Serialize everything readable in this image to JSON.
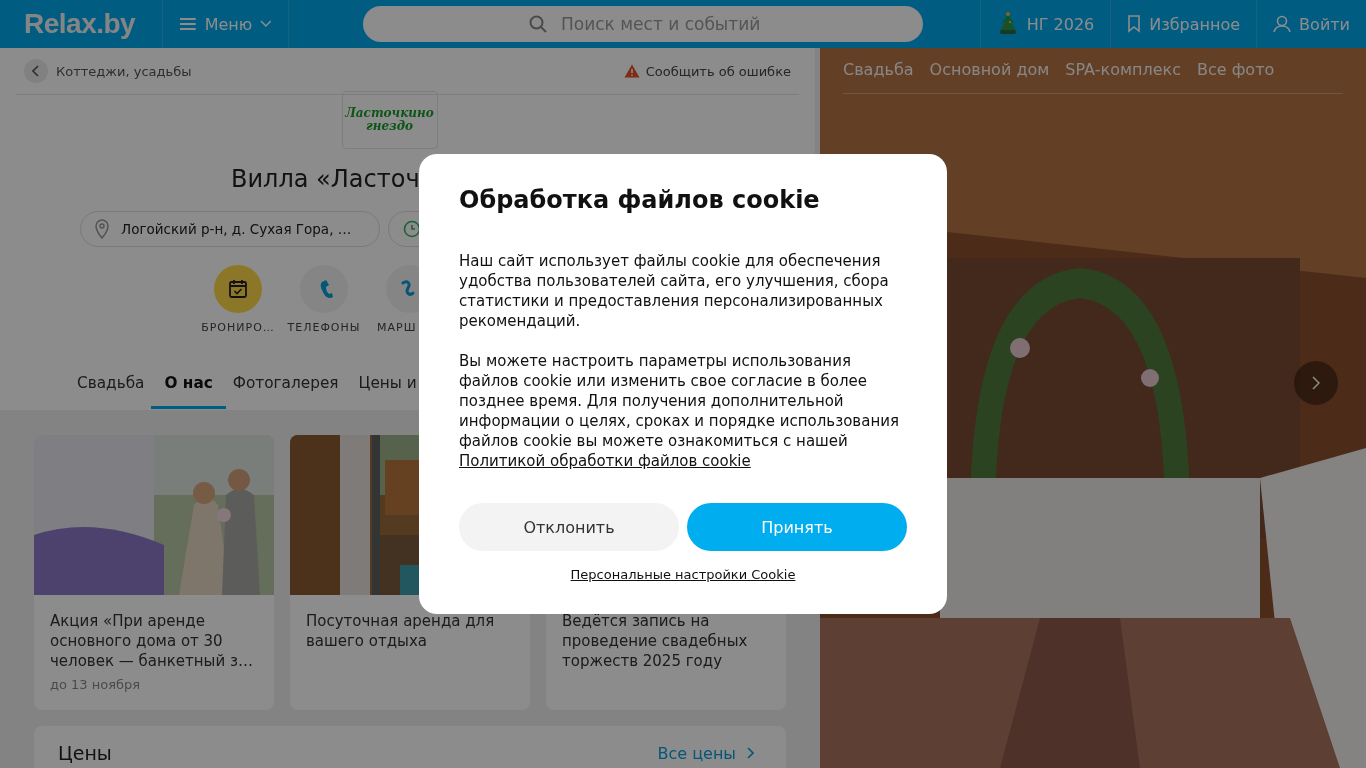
{
  "header": {
    "logo": "Relax.by",
    "menu": "Меню",
    "search": {
      "placeholder": "Поиск мест и событий"
    },
    "links": [
      {
        "kind": "newyear",
        "label": "НГ 2026"
      },
      {
        "kind": "favorites",
        "label": "Избранное"
      },
      {
        "kind": "login",
        "label": "Войти"
      }
    ]
  },
  "breadcrumb": {
    "label": "Коттеджи, усадьбы",
    "report": "Сообщить об ошибке"
  },
  "place": {
    "logo": "Ласточкино гнездо",
    "title": "Вилла «Ласточ",
    "chips": [
      {
        "kind": "address",
        "label": "Логойский р-н, д. Сухая Гора, …"
      },
      {
        "kind": "hours"
      }
    ]
  },
  "actions": [
    {
      "kind": "booking",
      "label": "БРОНИРО…",
      "highlighted": true
    },
    {
      "kind": "phones",
      "label": "ТЕЛЕФОНЫ",
      "highlighted": false
    },
    {
      "kind": "route",
      "label": "МАРШ",
      "highlighted": false
    }
  ],
  "tabs": [
    {
      "label": "Свадьба",
      "selected": false
    },
    {
      "label": "О нас",
      "selected": true
    },
    {
      "label": "Фотогалерея",
      "selected": false
    },
    {
      "label": "Цены и",
      "selected": false
    }
  ],
  "offers": [
    {
      "kind": "picture",
      "text": "Акция «При аренде основного дома от 30 человек — банкетный з…",
      "date": "до 13 ноября"
    },
    {
      "kind": "picture",
      "text": "Посуточная аренда для вашего отдыха"
    },
    {
      "text": "Ведётся запись на проведение свадебных торжеств 2025 году"
    }
  ],
  "prices": {
    "title": "Цены",
    "link": "Все цены"
  },
  "gallery": {
    "tabs": [
      "Свадьба",
      "Основной дом",
      "SPA-комплекс",
      "Все фото"
    ]
  },
  "cookie": {
    "title": "Обработка файлов cookie",
    "paragraphs": [
      "Наш сайт использует файлы cookie для обеспечения удобства пользователей сайта, его улучшения, сбора статистики и предоставления персонализированных рекомендаций.",
      "Вы можете настроить параметры использования файлов cookie или изменить свое согласие в более позднее время. Для получения дополнительной информации о целях, сроках и порядке использования файлов cookie вы можете ознакомиться с нашей"
    ],
    "policy_link": "Политикой обработки файлов cookie",
    "decline": "Отклонить",
    "accept": "Принять",
    "settings": "Персональные настройки Cookie"
  }
}
